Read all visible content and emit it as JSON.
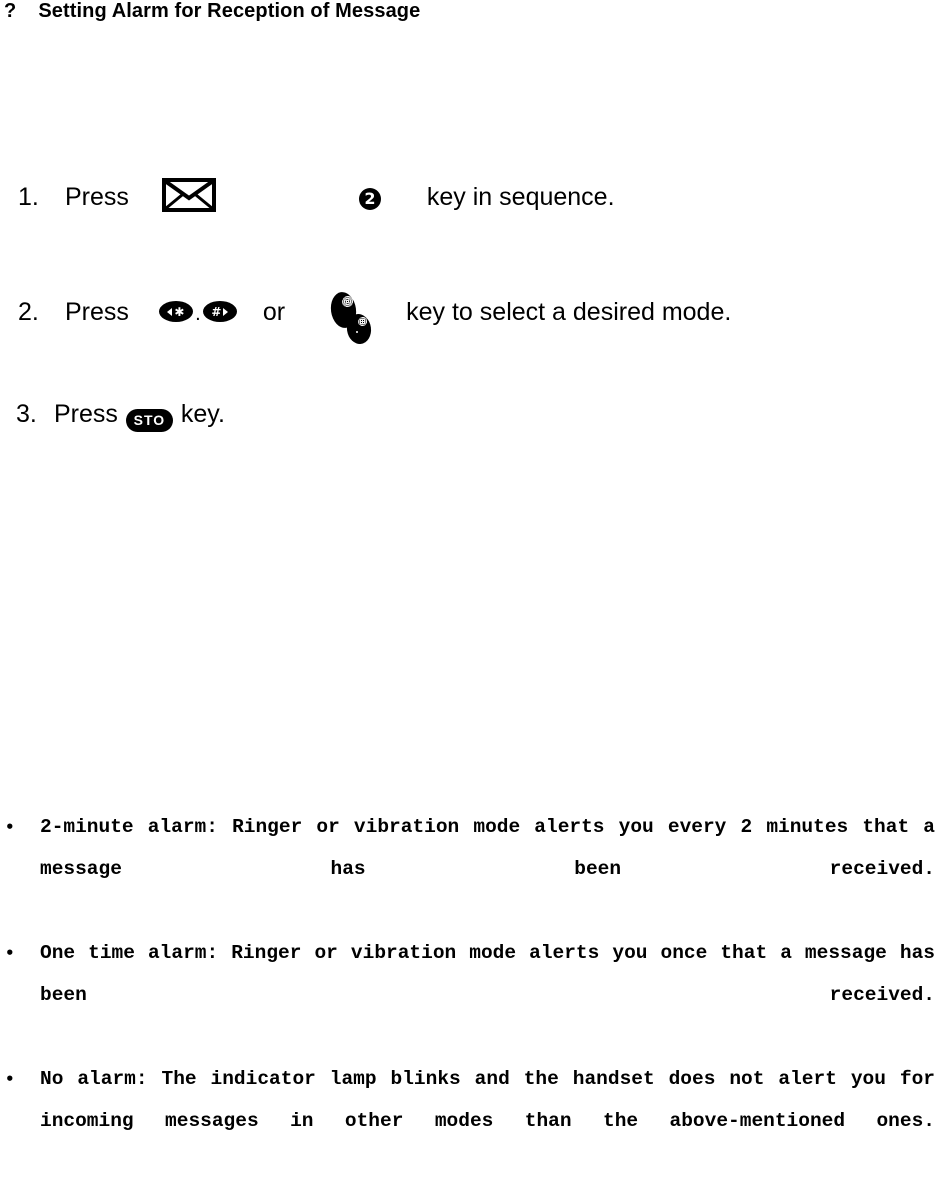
{
  "heading": {
    "marker": "?",
    "text": "Setting Alarm for Reception of Message"
  },
  "steps": [
    {
      "number": "1.",
      "verb": "Press",
      "icon_1": "envelope-icon",
      "icon_2_label": "2",
      "tail": "key in sequence."
    },
    {
      "number": "2.",
      "verb": "Press",
      "key_left_glyph": "✱",
      "key_separator": ".",
      "key_right_glyph": "#",
      "conjunction": "or",
      "icon_scroll": "scroll-up-down-keys-icon",
      "tail": "key to select a desired mode."
    },
    {
      "number": "3.",
      "verb": "Press",
      "key_label": "STO",
      "tail": "key."
    }
  ],
  "notes": [
    {
      "bullet": "•",
      "text": "2-minute alarm: Ringer or vibration mode alerts you every 2 minutes that a message has been received."
    },
    {
      "bullet": "•",
      "text": "One time alarm: Ringer or vibration mode alerts you once that a message has been received."
    },
    {
      "bullet": "•",
      "text": "No alarm: The indicator lamp blinks and the handset does not alert you for incoming messages in other modes than the above-mentioned ones."
    }
  ],
  "colors": {
    "page_background": "#ffffff",
    "text": "#000000",
    "key_fill": "#000000",
    "key_glyph": "#ffffff"
  }
}
